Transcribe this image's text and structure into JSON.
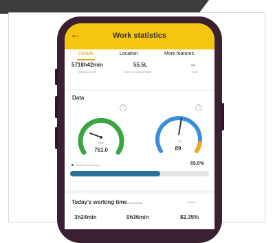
{
  "header": {
    "title": "Work statistics",
    "back_icon": "←"
  },
  "tabs": [
    {
      "label": "Details",
      "active": true
    },
    {
      "label": "Location",
      "active": false
    },
    {
      "label": "More features",
      "active": false
    }
  ],
  "stats": [
    {
      "value": "5718h42min",
      "label": "Working hours"
    },
    {
      "value": "55.5L",
      "label": "Daily fuel consumption"
    },
    {
      "value": "--",
      "label": "Gear"
    }
  ],
  "data_section": {
    "title": "Data",
    "help_icon": "?",
    "gauge_left": {
      "value": "751.0",
      "needle_label": "rpm",
      "color": "#3aa642",
      "level": 0.65
    },
    "gauge_right": {
      "value": "89",
      "needle_label": "°C",
      "color": "#3b8fd9",
      "accent_color": "#f5a623",
      "level": 0.5
    },
    "fuel": {
      "label": "Today's fuel level(?)",
      "percent": "65.0%",
      "fraction": 0.65,
      "color": "#2a6e9c"
    }
  },
  "working_time": {
    "title": "Today's working time",
    "date": "(01/21/2023)",
    "details_label": "Details >",
    "values": [
      "3h24min",
      "0h36min",
      "82.35%"
    ]
  },
  "colors": {
    "accent": "#f5c510",
    "phone_body": "#3a2030"
  }
}
